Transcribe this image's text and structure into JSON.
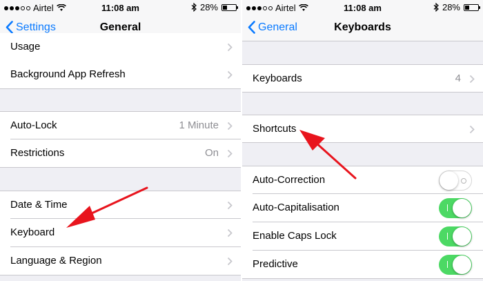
{
  "status_bar": {
    "carrier": "Airtel",
    "time": "11:08 am",
    "battery_percent": "28%",
    "battery_level": 0.28
  },
  "left_screen": {
    "nav": {
      "back_label": "Settings",
      "title": "General"
    },
    "rows": {
      "usage": {
        "label": "Usage"
      },
      "background_app_refresh": {
        "label": "Background App Refresh"
      },
      "auto_lock": {
        "label": "Auto-Lock",
        "value": "1 Minute"
      },
      "restrictions": {
        "label": "Restrictions",
        "value": "On"
      },
      "date_time": {
        "label": "Date & Time"
      },
      "keyboard": {
        "label": "Keyboard"
      },
      "language_region": {
        "label": "Language & Region"
      }
    }
  },
  "right_screen": {
    "nav": {
      "back_label": "General",
      "title": "Keyboards"
    },
    "rows": {
      "keyboards": {
        "label": "Keyboards",
        "value": "4"
      },
      "shortcuts": {
        "label": "Shortcuts"
      },
      "auto_correction": {
        "label": "Auto-Correction",
        "on": false
      },
      "auto_capitalisation": {
        "label": "Auto-Capitalisation",
        "on": true
      },
      "enable_caps_lock": {
        "label": "Enable Caps Lock",
        "on": true
      },
      "predictive": {
        "label": "Predictive",
        "on": true
      }
    }
  },
  "colors": {
    "ios_blue": "#0a7aff",
    "toggle_green": "#4cd964",
    "annotation_red": "#e8141d",
    "group_background": "#efeff4"
  },
  "icons": [
    "wifi-icon",
    "bluetooth-icon",
    "battery-icon",
    "back-chevron-icon",
    "chevron-right-icon",
    "red-arrow-annotation"
  ]
}
